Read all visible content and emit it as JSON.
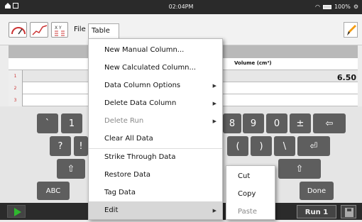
{
  "status": {
    "time": "02:04PM",
    "battery": "100%"
  },
  "menubar": {
    "file": "File",
    "table": "Table"
  },
  "table": {
    "column_header": "Volume (cm³)",
    "rows": [
      "1",
      "2",
      "3"
    ],
    "cell_value": "6.50"
  },
  "menu": {
    "items": [
      {
        "label": "New Manual Column...",
        "arrow": false,
        "disabled": false
      },
      {
        "label": "New Calculated Column...",
        "arrow": false,
        "disabled": false
      },
      {
        "label": "Data Column Options",
        "arrow": true,
        "disabled": false
      },
      {
        "label": "Delete Data Column",
        "arrow": true,
        "disabled": false
      },
      {
        "label": "Delete Run",
        "arrow": true,
        "disabled": true
      },
      {
        "label": "Clear All Data",
        "arrow": false,
        "disabled": false
      },
      {
        "label": "Strike Through Data",
        "arrow": false,
        "disabled": false
      },
      {
        "label": "Restore Data",
        "arrow": false,
        "disabled": false
      },
      {
        "label": "Tag Data",
        "arrow": false,
        "disabled": false
      },
      {
        "label": "Edit",
        "arrow": true,
        "disabled": false
      }
    ]
  },
  "submenu": {
    "cut": "Cut",
    "copy": "Copy",
    "paste": "Paste"
  },
  "keyboard": {
    "row1": [
      "`",
      "1",
      "8",
      "9",
      "0",
      "±",
      "⇦"
    ],
    "row2": [
      "?",
      "!",
      "(",
      ")",
      "\\",
      "⏎"
    ],
    "row3": [
      "⇧",
      "⇧"
    ],
    "row4": [
      "ABC",
      "Done"
    ]
  },
  "bottom": {
    "run_label": "Run 1"
  },
  "colors": {
    "accent_green": "#2fb82f",
    "menu_bg": "#ffffff",
    "key_bg": "#5e5e5e"
  }
}
